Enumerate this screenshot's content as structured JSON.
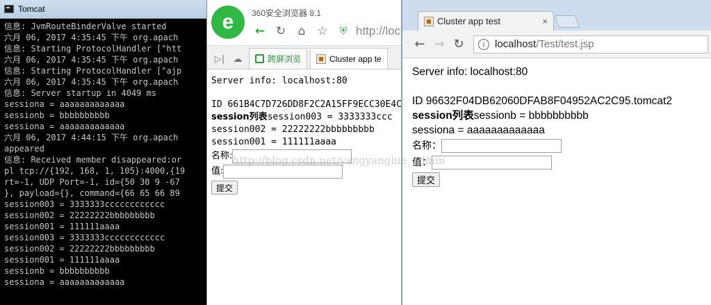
{
  "console": {
    "title": "Tomcat",
    "lines": [
      "信息: JvmRouteBinderValve started",
      "六月 06, 2017 4:35:45 下午 org.apach",
      "信息: Starting ProtocolHandler [\"htt",
      "六月 06, 2017 4:35:45 下午 org.apach",
      "信息: Starting ProtocolHandler [\"ajp",
      "六月 06, 2017 4:35:45 下午 org.apach",
      "信息: Server startup in 4049 ms",
      "sessiona = aaaaaaaaaaaaa",
      "sessionb = bbbbbbbbbb",
      "sessiona = aaaaaaaaaaaaa",
      "六月 06, 2017 4:44:15 下午 org.apach",
      "appeared",
      "信息: Received member disappeared:or",
      "pl tcp://{192, 168, 1, 105}:4000,{19",
      "rt=-1, UDP Port=-1, id={50 30 9 -67 ",
      "}, payload={}, command={66 65 66 89 ",
      "session003 = 3333333cccccccccccc",
      "session002 = 22222222bbbbbbbbb",
      "session001 = 111111aaaa",
      "session003 = 3333333cccccccccccc",
      "session002 = 22222222bbbbbbbbb",
      "session001 = 111111aaaa",
      "sessionb = bbbbbbbbbb",
      "sessiona = aaaaaaaaaaaaa"
    ]
  },
  "browser360": {
    "name": "360安全浏览器 8.1",
    "url": "http://loc",
    "tab_green": "跨屏浏览",
    "tab_active": "Cluster app te",
    "server_info": "Server info: localhost:80",
    "id_line": "ID 661B4C7D726DD8F2C2A15FF9ECC30E4C",
    "session_heading": "session列表",
    "first_session": "session003 = 3333333ccc",
    "sessions": [
      "session002 = 22222222bbbbbbbbb",
      "session001 = 111111aaaa"
    ],
    "name_label": "名称:",
    "value_label": "值:",
    "submit": "提交"
  },
  "chrome": {
    "tab_title": "Cluster app test",
    "tab_close": "×",
    "url_host": "localhost",
    "url_path": "/Test/test.jsp",
    "server_info": "Server info: localhost:80",
    "id_line": "ID 96632F04DB62060DFAB8F04952AC2C95.tomcat2",
    "session_heading": "session列表",
    "first_session": "sessionb = bbbbbbbbbb",
    "sessions": [
      "sessiona = aaaaaaaaaaaaa"
    ],
    "name_label": "名称：",
    "value_label": "值：",
    "submit": "提交"
  },
  "watermark": "http://blog.csdn.net/yangyanglue_admin"
}
